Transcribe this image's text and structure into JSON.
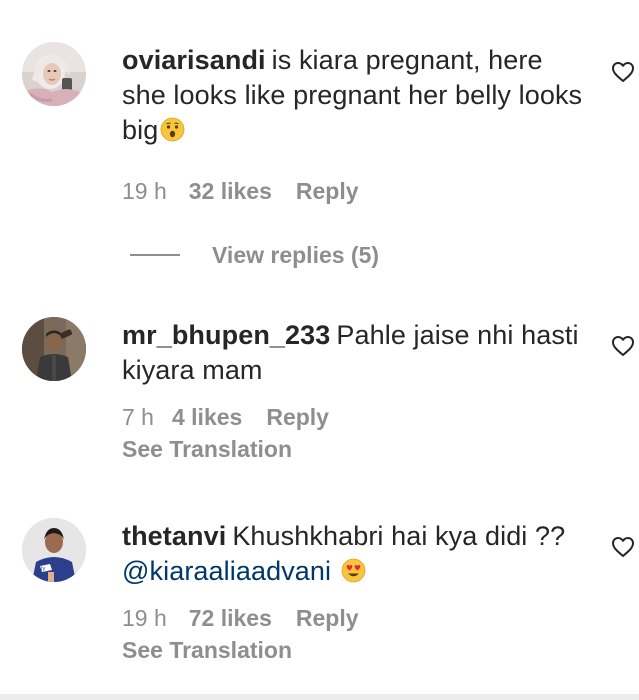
{
  "comments": [
    {
      "username": "oviarisandi",
      "text": "is kiara pregnant, here she looks like pregnant her belly looks big",
      "emoji_icon": "hushed-face-emoji",
      "time": "19 h",
      "likes": "32 likes",
      "reply_label": "Reply"
    },
    {
      "username": "mr_bhupen_233",
      "text": "Pahle jaise nhi hasti kiyara mam",
      "time": "7 h",
      "likes": "4 likes",
      "reply_label": "Reply",
      "translation_label": "See Translation"
    },
    {
      "username": "thetanvi",
      "text": "Khushkhabri hai kya didi ??",
      "mention": "@kiaraaliaadvani",
      "emoji_icon": "heart-eyes-emoji",
      "time": "19 h",
      "likes": "72 likes",
      "reply_label": "Reply",
      "translation_label": "See Translation"
    }
  ],
  "view_replies": {
    "label": "View replies (5)"
  },
  "colors": {
    "text": "#262626",
    "secondary": "#8e8e8e",
    "mention": "#00376b",
    "background": "#ffffff"
  }
}
